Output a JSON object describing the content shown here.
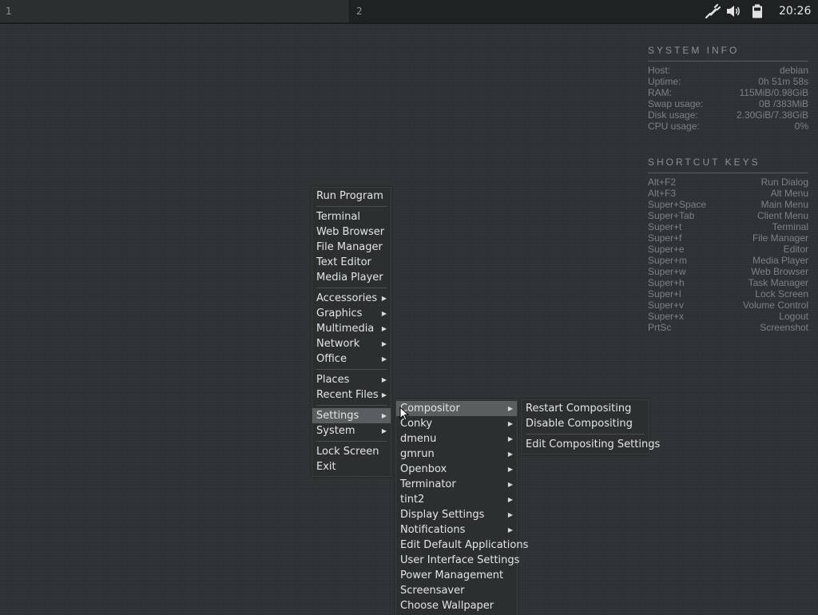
{
  "panel": {
    "workspace_1": "1",
    "workspace_2": "2",
    "tray_icons": [
      "network-icon",
      "volume-icon",
      "battery-icon"
    ],
    "clock": "20:26"
  },
  "conky": {
    "system_info": {
      "heading": "SYSTEM INFO",
      "rows": [
        {
          "label": "Host:",
          "value": "debian"
        },
        {
          "label": "Uptime:",
          "value": "0h 51m 58s"
        },
        {
          "label": "RAM:",
          "value": "115MiB/0.98GiB"
        },
        {
          "label": "Swap usage:",
          "value": "0B  /383MiB"
        },
        {
          "label": "Disk usage:",
          "value": "2.30GiB/7.38GiB"
        },
        {
          "label": "CPU usage:",
          "value": "0%"
        }
      ]
    },
    "shortcut_keys": {
      "heading": "SHORTCUT KEYS",
      "rows": [
        {
          "key": "Alt+F2",
          "action": "Run Dialog"
        },
        {
          "key": "Alt+F3",
          "action": "Alt Menu"
        },
        {
          "key": "Super+Space",
          "action": "Main Menu"
        },
        {
          "key": "Super+Tab",
          "action": "Client Menu"
        },
        {
          "key": "Super+t",
          "action": "Terminal"
        },
        {
          "key": "Super+f",
          "action": "File Manager"
        },
        {
          "key": "Super+e",
          "action": "Editor"
        },
        {
          "key": "Super+m",
          "action": "Media Player"
        },
        {
          "key": "Super+w",
          "action": "Web Browser"
        },
        {
          "key": "Super+h",
          "action": "Task Manager"
        },
        {
          "key": "Super+l",
          "action": "Lock Screen"
        },
        {
          "key": "Super+v",
          "action": "Volume Control"
        },
        {
          "key": "Super+x",
          "action": "Logout"
        },
        {
          "key": "PrtSc",
          "action": "Screenshot"
        }
      ]
    }
  },
  "root_menu": {
    "groups": [
      [
        {
          "label": "Run Program"
        }
      ],
      [
        {
          "label": "Terminal"
        },
        {
          "label": "Web Browser"
        },
        {
          "label": "File Manager"
        },
        {
          "label": "Text Editor"
        },
        {
          "label": "Media Player"
        }
      ],
      [
        {
          "label": "Accessories",
          "sub": true
        },
        {
          "label": "Graphics",
          "sub": true
        },
        {
          "label": "Multimedia",
          "sub": true
        },
        {
          "label": "Network",
          "sub": true
        },
        {
          "label": "Office",
          "sub": true
        }
      ],
      [
        {
          "label": "Places",
          "sub": true
        },
        {
          "label": "Recent Files",
          "sub": true
        }
      ],
      [
        {
          "label": "Settings",
          "sub": true,
          "selected": true
        },
        {
          "label": "System",
          "sub": true
        }
      ],
      [
        {
          "label": "Lock Screen"
        },
        {
          "label": "Exit"
        }
      ]
    ]
  },
  "settings_menu": {
    "groups": [
      [
        {
          "label": "Compositor",
          "sub": true,
          "selected": true
        },
        {
          "label": "Conky",
          "sub": true
        },
        {
          "label": "dmenu",
          "sub": true
        },
        {
          "label": "gmrun",
          "sub": true
        },
        {
          "label": "Openbox",
          "sub": true
        },
        {
          "label": "Terminator",
          "sub": true
        },
        {
          "label": "tint2",
          "sub": true
        },
        {
          "label": "Display Settings",
          "sub": true
        },
        {
          "label": "Notifications",
          "sub": true
        },
        {
          "label": "Edit Default Applications"
        },
        {
          "label": "User Interface Settings"
        },
        {
          "label": "Power Management"
        },
        {
          "label": "Screensaver"
        },
        {
          "label": "Choose Wallpaper"
        }
      ]
    ]
  },
  "compositor_menu": {
    "groups": [
      [
        {
          "label": "Restart Compositing"
        },
        {
          "label": "Disable Compositing"
        }
      ],
      [
        {
          "label": "Edit Compositing Settings"
        }
      ]
    ]
  },
  "arrow_glyph": "▶"
}
